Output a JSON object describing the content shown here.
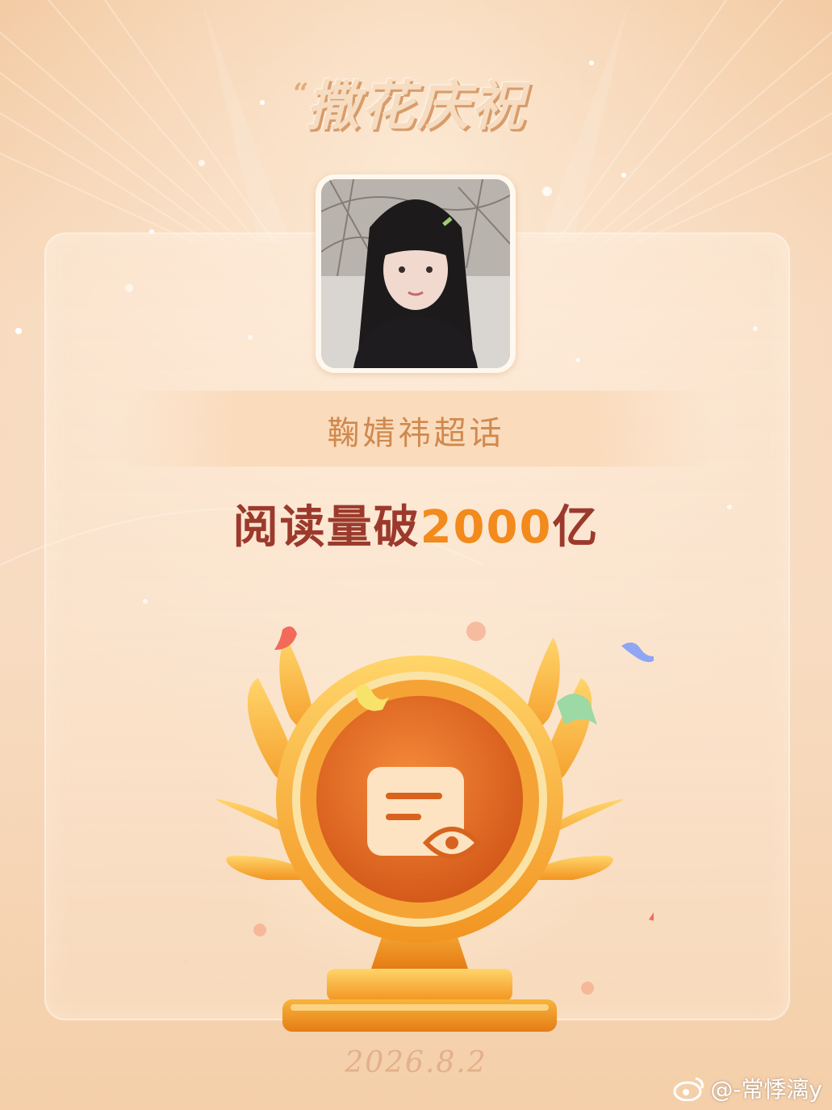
{
  "banner": {
    "title": "撒花庆祝",
    "title_quote_mark": "“"
  },
  "topic": {
    "name": "鞠婧祎超话"
  },
  "milestone": {
    "prefix": "阅读量破",
    "number": "2000",
    "suffix": "亿"
  },
  "badge": {
    "icon": "document-eye-icon"
  },
  "date": "2026.8.2",
  "watermark": {
    "text": "@-常悸漓y",
    "icon": "weibo-logo-icon"
  },
  "colors": {
    "background": "#f6d3b2",
    "headline": "#9b3a2c",
    "accent_number": "#f28a1c",
    "topic_text": "#d0894e",
    "trophy_gold": "#f6a323",
    "medal_center": "#e8722a"
  }
}
